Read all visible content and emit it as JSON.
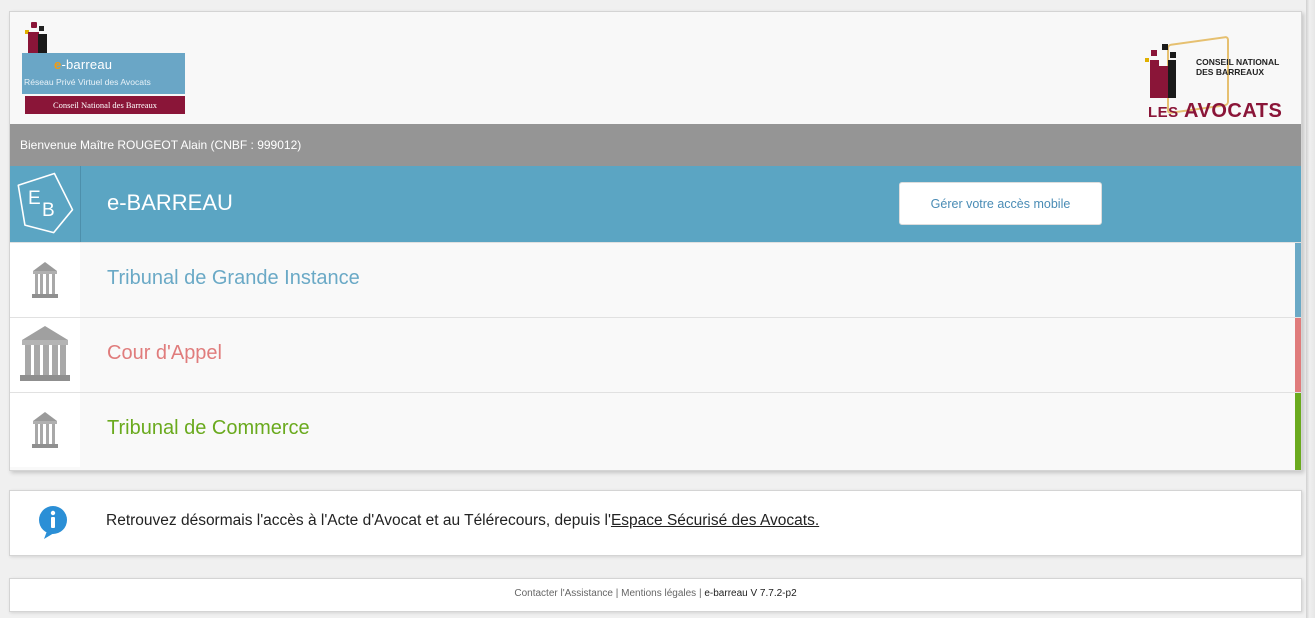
{
  "header": {
    "eb_logo": {
      "brand_prefix": "e",
      "brand_suffix": "-barreau",
      "subtitle": "Réseau Privé Virtuel des Avocats",
      "org": "Conseil National des Barreaux"
    },
    "cnb_logo": {
      "line1": "CONSEIL NATIONAL",
      "line2": "DES BARREAUX",
      "les": "LES",
      "avocats": "AVOCATS"
    }
  },
  "welcome": {
    "text": "Bienvenue Maître ROUGEOT Alain (CNBF : 999012)"
  },
  "ebarreau": {
    "icon_letters": {
      "e": "E",
      "b": "B"
    },
    "title": "e-BARREAU",
    "mobile_button": "Gérer votre accès mobile"
  },
  "courts": [
    {
      "label": "Tribunal de Grande Instance",
      "color": "#6aa9c6"
    },
    {
      "label": "Cour d'Appel",
      "color": "#e07c7c"
    },
    {
      "label": "Tribunal de Commerce",
      "color": "#6aaa1e"
    }
  ],
  "info": {
    "text": "Retrouvez désormais l'accès à l'Acte d'Avocat et au Télérecours, depuis l'",
    "link": "Espace Sécurisé des Avocats."
  },
  "footer": {
    "assistance": "Contacter l'Assistance",
    "sep1": " | ",
    "legal": "Mentions légales",
    "sep2": " | ",
    "version": "e-barreau V 7.7.2-p2"
  },
  "colors": {
    "brand_blue": "#5ba5c3",
    "welcome_gray": "#959595",
    "burgundy": "#8a1538"
  }
}
